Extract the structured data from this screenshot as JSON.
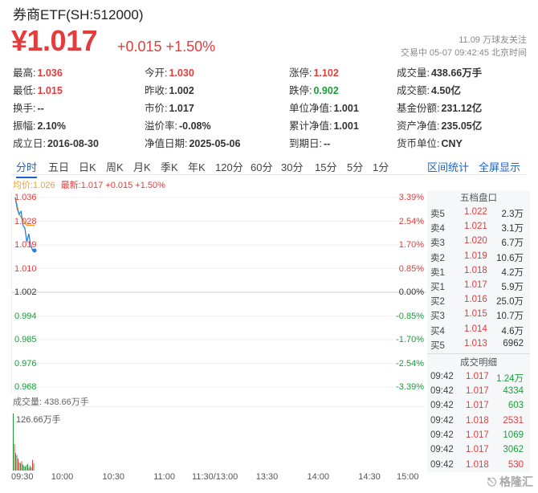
{
  "header": {
    "title": "券商ETF(SH:512000)",
    "price": "¥1.017",
    "change": "+0.015 +1.50%",
    "followers": "11.09 万球友关注",
    "status_time": "交易中 05-07 09:42:45 北京时间"
  },
  "stats": {
    "high_label": "最高:",
    "high": "1.036",
    "low_label": "最低:",
    "low": "1.015",
    "turnover_label": "换手:",
    "turnover": "--",
    "amplitude_label": "振幅:",
    "amplitude": "2.10%",
    "founded_label": "成立日:",
    "founded": "2016-08-30",
    "open_label": "今开:",
    "open": "1.030",
    "prev_close_label": "昨收:",
    "prev_close": "1.002",
    "price_label": "市价:",
    "market_price": "1.017",
    "premium_label": "溢价率:",
    "premium": "-0.08%",
    "nav_date_label": "净值日期:",
    "nav_date": "2025-05-06",
    "limit_up_label": "涨停:",
    "limit_up": "1.102",
    "limit_down_label": "跌停:",
    "limit_down": "0.902",
    "unit_nav_label": "单位净值:",
    "unit_nav": "1.001",
    "cum_nav_label": "累计净值:",
    "cum_nav": "1.001",
    "expiry_label": "到期日:",
    "expiry": "--",
    "volume_label": "成交量:",
    "volume": "438.66万手",
    "amount_label": "成交额:",
    "amount": "4.50亿",
    "fund_share_label": "基金份额:",
    "fund_share": "231.12亿",
    "net_assets_label": "资产净值:",
    "net_assets": "235.05亿",
    "currency_label": "货币单位:",
    "currency": "CNY"
  },
  "tabs": [
    "分时",
    "五日",
    "日K",
    "周K",
    "月K",
    "季K",
    "年K",
    "120分",
    "60分",
    "30分",
    "15分",
    "5分",
    "1分"
  ],
  "tabs_right": [
    "区间统计",
    "全屏显示"
  ],
  "chart_info": {
    "avg": "均价:1.026",
    "latest": "最新:1.017 +0.015 +1.50%"
  },
  "y_left": [
    "1.036",
    "1.028",
    "1.019",
    "1.010",
    "1.002",
    "0.994",
    "0.985",
    "0.976",
    "0.968"
  ],
  "y_right": [
    "3.39%",
    "2.54%",
    "1.70%",
    "0.85%",
    "0.00%",
    "-0.85%",
    "-1.70%",
    "-2.54%",
    "-3.39%"
  ],
  "volume_title": "成交量: 438.66万手",
  "volume_max": "126.66万手",
  "time_axis": [
    "09:30",
    "10:00",
    "10:30",
    "11:00",
    "11:30/13:00",
    "13:30",
    "14:00",
    "14:30",
    "15:00"
  ],
  "orderbook": {
    "title": "五档盘口",
    "rows": [
      {
        "label": "卖5",
        "price": "1.022",
        "vol": "2.3万"
      },
      {
        "label": "卖4",
        "price": "1.021",
        "vol": "3.1万"
      },
      {
        "label": "卖3",
        "price": "1.020",
        "vol": "6.7万"
      },
      {
        "label": "卖2",
        "price": "1.019",
        "vol": "10.6万"
      },
      {
        "label": "卖1",
        "price": "1.018",
        "vol": "4.2万"
      },
      {
        "label": "买1",
        "price": "1.017",
        "vol": "5.9万"
      },
      {
        "label": "买2",
        "price": "1.016",
        "vol": "25.0万"
      },
      {
        "label": "买3",
        "price": "1.015",
        "vol": "10.7万"
      },
      {
        "label": "买4",
        "price": "1.014",
        "vol": "4.6万"
      },
      {
        "label": "买5",
        "price": "1.013",
        "vol": "6962"
      }
    ]
  },
  "trades": {
    "title": "成交明细",
    "rows": [
      {
        "time": "09:42",
        "price": "1.017",
        "vol": "1.24万",
        "color": "#1a9e3a"
      },
      {
        "time": "09:42",
        "price": "1.017",
        "vol": "4334",
        "color": "#1a9e3a"
      },
      {
        "time": "09:42",
        "price": "1.017",
        "vol": "603",
        "color": "#1a9e3a"
      },
      {
        "time": "09:42",
        "price": "1.018",
        "vol": "2531",
        "color": "#e43c3c"
      },
      {
        "time": "09:42",
        "price": "1.017",
        "vol": "1069",
        "color": "#1a9e3a"
      },
      {
        "time": "09:42",
        "price": "1.017",
        "vol": "3062",
        "color": "#1a9e3a"
      },
      {
        "time": "09:42",
        "price": "1.018",
        "vol": "530",
        "color": "#e43c3c"
      }
    ]
  },
  "watermark": "格隆汇",
  "colors": {
    "up": "#e43c3c",
    "down": "#1a9e3a",
    "accent": "#1a63c7",
    "avg": "#f0a020"
  },
  "chart_data": {
    "type": "line",
    "price_line": [
      1.036,
      1.032,
      1.03,
      1.031,
      1.026,
      1.025,
      1.02,
      1.023,
      1.019,
      1.017,
      1.017
    ],
    "avg_line": [
      1.036,
      1.033,
      1.03,
      1.029,
      1.028,
      1.027,
      1.026,
      1.026,
      1.026,
      1.026,
      1.026
    ],
    "ylim": [
      0.968,
      1.036
    ],
    "volume_bars": [
      126.66,
      60,
      40,
      35,
      28,
      20,
      18,
      22,
      15,
      12,
      10,
      14,
      16,
      8,
      12,
      9,
      25,
      18
    ],
    "grid": true
  }
}
